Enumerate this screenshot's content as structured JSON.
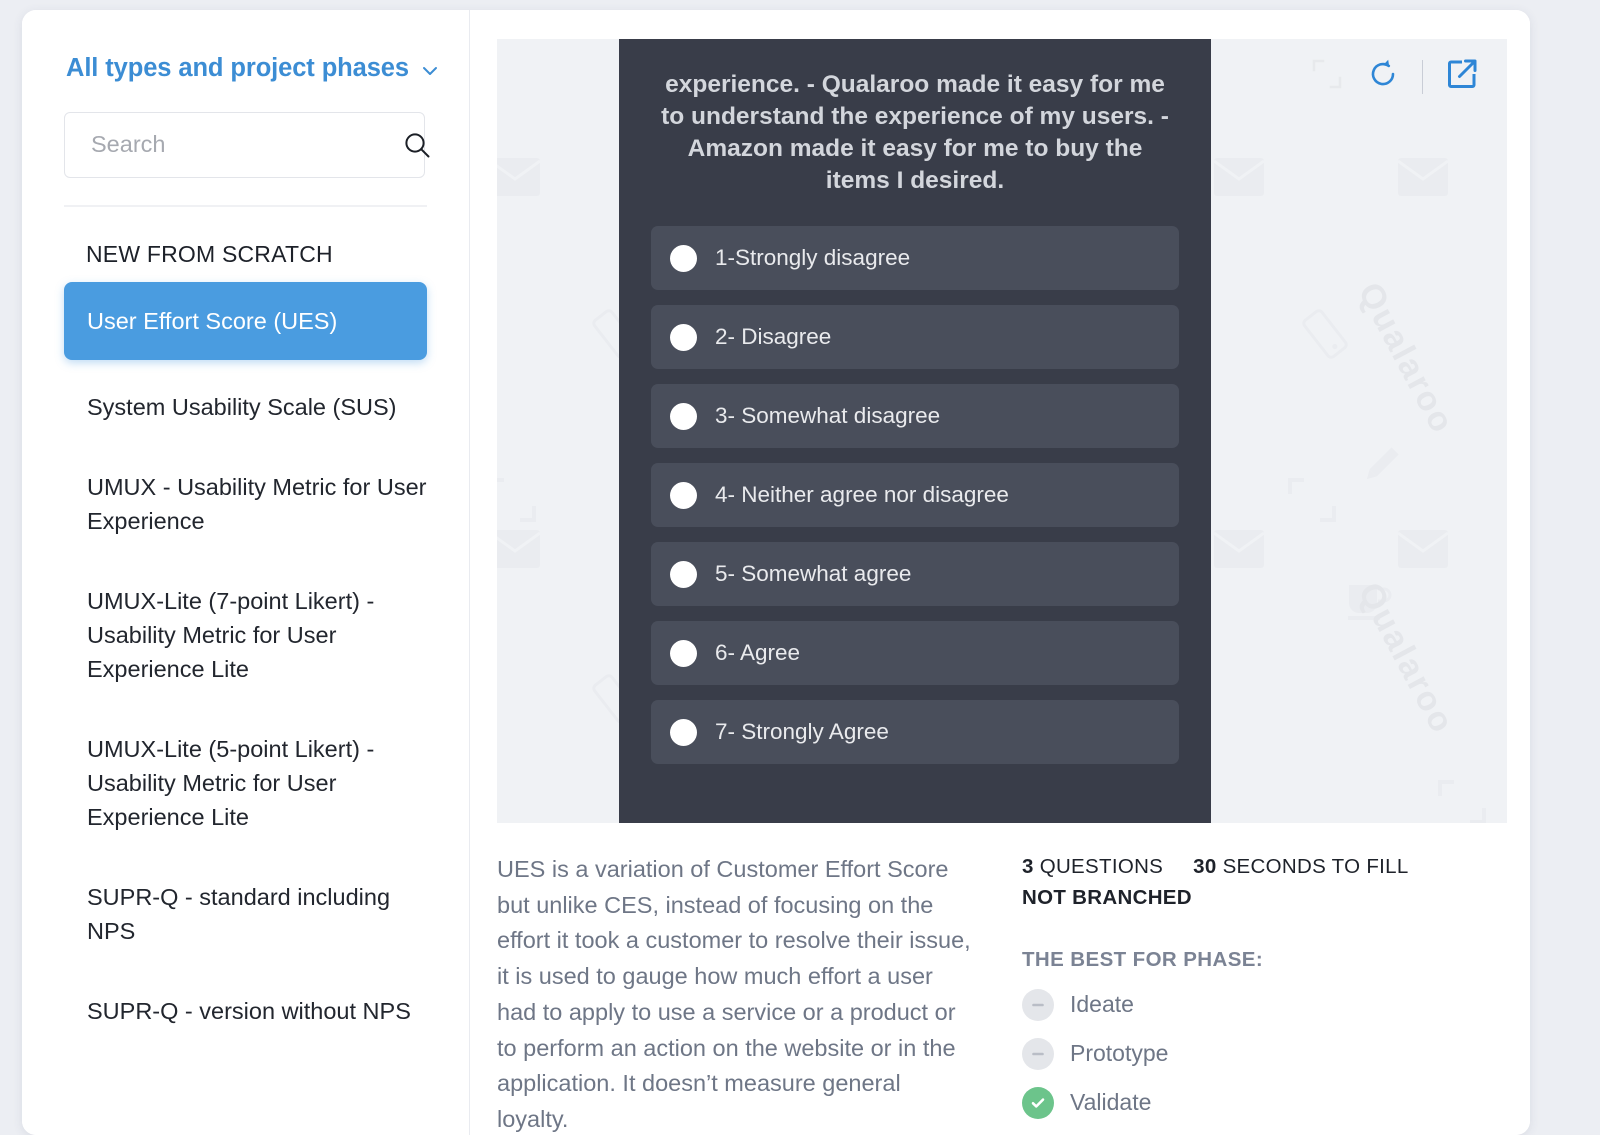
{
  "sidebar": {
    "filter_label": "All types and project phases",
    "chevron_icon": "chevron-down-icon",
    "search": {
      "value": "",
      "placeholder": "Search",
      "icon": "search-icon"
    },
    "group_title": "NEW FROM SCRATCH",
    "items": [
      {
        "label": "User Effort Score (UES)",
        "selected": true
      },
      {
        "label": "System Usability Scale (SUS)",
        "selected": false
      },
      {
        "label": "UMUX - Usability Metric for User Experience",
        "selected": false
      },
      {
        "label": "UMUX-Lite (7-point Likert) - Usability Metric for User Experience Lite",
        "selected": false
      },
      {
        "label": "UMUX-Lite (5-point Likert) - Usability Metric for User Experience Lite",
        "selected": false
      },
      {
        "label": "SUPR-Q - standard including NPS",
        "selected": false
      },
      {
        "label": "SUPR-Q - version without NPS",
        "selected": false
      }
    ]
  },
  "toolbar": {
    "resize_icon": "expand-corners-icon",
    "refresh_icon": "refresh-icon",
    "open_external_icon": "open-external-icon"
  },
  "preview": {
    "watermark_text": "Qualaroo",
    "question": "experience. - Qualaroo made it easy for me to understand the experience of my users. - Amazon made it easy for me to buy the items I desired.",
    "options": [
      "1-Strongly disagree",
      "2- Disagree",
      "3- Somewhat disagree",
      "4- Neither agree nor disagree",
      "5- Somewhat agree",
      "6- Agree",
      "7- Strongly Agree"
    ]
  },
  "details": {
    "description": "UES is a variation of Customer Effort Score but unlike CES, instead of focusing on the effort it took a customer to resolve their issue, it is used to gauge how much effort a user had to apply to use a service or a product or to perform an action on the website or in the application. It doesn’t measure general loyalty.",
    "questions_count": "3",
    "questions_label": "QUESTIONS",
    "seconds_count": "30",
    "seconds_label": "SECONDS TO FILL",
    "branching": "NOT BRANCHED",
    "phase_title": "THE BEST FOR PHASE:",
    "phases": [
      {
        "label": "Ideate",
        "active": false
      },
      {
        "label": "Prototype",
        "active": false
      },
      {
        "label": "Validate",
        "active": true
      }
    ]
  },
  "colors": {
    "accent_blue": "#4a9ce0",
    "link_blue": "#3c8dd4",
    "panel_dark": "#393d49",
    "option_dark": "#494e5b",
    "stage_gray": "#f0f2f5",
    "phase_active_green": "#6cc48b",
    "muted_text": "#6e7686"
  }
}
